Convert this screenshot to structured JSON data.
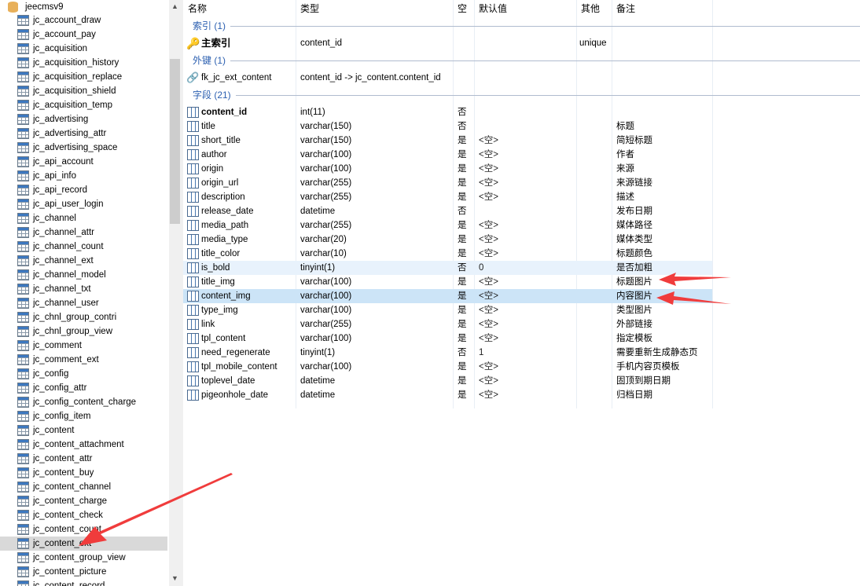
{
  "sidebar": {
    "database": "jeecmsv9",
    "selected": "jc_content_ext",
    "tables": [
      "jc_account_draw",
      "jc_account_pay",
      "jc_acquisition",
      "jc_acquisition_history",
      "jc_acquisition_replace",
      "jc_acquisition_shield",
      "jc_acquisition_temp",
      "jc_advertising",
      "jc_advertising_attr",
      "jc_advertising_space",
      "jc_api_account",
      "jc_api_info",
      "jc_api_record",
      "jc_api_user_login",
      "jc_channel",
      "jc_channel_attr",
      "jc_channel_count",
      "jc_channel_ext",
      "jc_channel_model",
      "jc_channel_txt",
      "jc_channel_user",
      "jc_chnl_group_contri",
      "jc_chnl_group_view",
      "jc_comment",
      "jc_comment_ext",
      "jc_config",
      "jc_config_attr",
      "jc_config_content_charge",
      "jc_config_item",
      "jc_content",
      "jc_content_attachment",
      "jc_content_attr",
      "jc_content_buy",
      "jc_content_channel",
      "jc_content_charge",
      "jc_content_check",
      "jc_content_count",
      "jc_content_ext",
      "jc_content_group_view",
      "jc_content_picture",
      "jc_content_record"
    ]
  },
  "columns": [
    "名称",
    "类型",
    "空",
    "默认值",
    "其他",
    "备注"
  ],
  "groups": {
    "index": "索引 (1)",
    "foreign": "外键 (1)",
    "fields": "字段 (21)"
  },
  "index_row": {
    "name": "主索引",
    "type": "content_id",
    "other": "unique",
    "icon": "key-icon"
  },
  "foreign_row": {
    "name": "fk_jc_ext_content",
    "type": "content_id -> jc_content.content_id",
    "icon": "link-icon"
  },
  "fields": [
    {
      "name": "content_id",
      "type": "int(11)",
      "null": "否",
      "default": "",
      "comment": ""
    },
    {
      "name": "title",
      "type": "varchar(150)",
      "null": "否",
      "default": "",
      "comment": "标题"
    },
    {
      "name": "short_title",
      "type": "varchar(150)",
      "null": "是",
      "default": "<空>",
      "comment": "简短标题"
    },
    {
      "name": "author",
      "type": "varchar(100)",
      "null": "是",
      "default": "<空>",
      "comment": "作者"
    },
    {
      "name": "origin",
      "type": "varchar(100)",
      "null": "是",
      "default": "<空>",
      "comment": "来源"
    },
    {
      "name": "origin_url",
      "type": "varchar(255)",
      "null": "是",
      "default": "<空>",
      "comment": "来源链接"
    },
    {
      "name": "description",
      "type": "varchar(255)",
      "null": "是",
      "default": "<空>",
      "comment": "描述"
    },
    {
      "name": "release_date",
      "type": "datetime",
      "null": "否",
      "default": "",
      "comment": "发布日期"
    },
    {
      "name": "media_path",
      "type": "varchar(255)",
      "null": "是",
      "default": "<空>",
      "comment": "媒体路径"
    },
    {
      "name": "media_type",
      "type": "varchar(20)",
      "null": "是",
      "default": "<空>",
      "comment": "媒体类型"
    },
    {
      "name": "title_color",
      "type": "varchar(10)",
      "null": "是",
      "default": "<空>",
      "comment": "标题颜色"
    },
    {
      "name": "is_bold",
      "type": "tinyint(1)",
      "null": "否",
      "default": "0",
      "comment": "是否加粗"
    },
    {
      "name": "title_img",
      "type": "varchar(100)",
      "null": "是",
      "default": "<空>",
      "comment": "标题图片"
    },
    {
      "name": "content_img",
      "type": "varchar(100)",
      "null": "是",
      "default": "<空>",
      "comment": "内容图片"
    },
    {
      "name": "type_img",
      "type": "varchar(100)",
      "null": "是",
      "default": "<空>",
      "comment": "类型图片"
    },
    {
      "name": "link",
      "type": "varchar(255)",
      "null": "是",
      "default": "<空>",
      "comment": "外部链接"
    },
    {
      "name": "tpl_content",
      "type": "varchar(100)",
      "null": "是",
      "default": "<空>",
      "comment": "指定模板"
    },
    {
      "name": "need_regenerate",
      "type": "tinyint(1)",
      "null": "否",
      "default": "1",
      "comment": "需要重新生成静态页"
    },
    {
      "name": "tpl_mobile_content",
      "type": "varchar(100)",
      "null": "是",
      "default": "<空>",
      "comment": "手机内容页模板"
    },
    {
      "name": "toplevel_date",
      "type": "datetime",
      "null": "是",
      "default": "<空>",
      "comment": "固顶到期日期"
    },
    {
      "name": "pigeonhole_date",
      "type": "datetime",
      "null": "是",
      "default": "<空>",
      "comment": "归档日期"
    }
  ],
  "colors": {
    "accent": "#2b5fb0",
    "arrow": "#f03c3c",
    "selected_row": "#cce4f7"
  }
}
